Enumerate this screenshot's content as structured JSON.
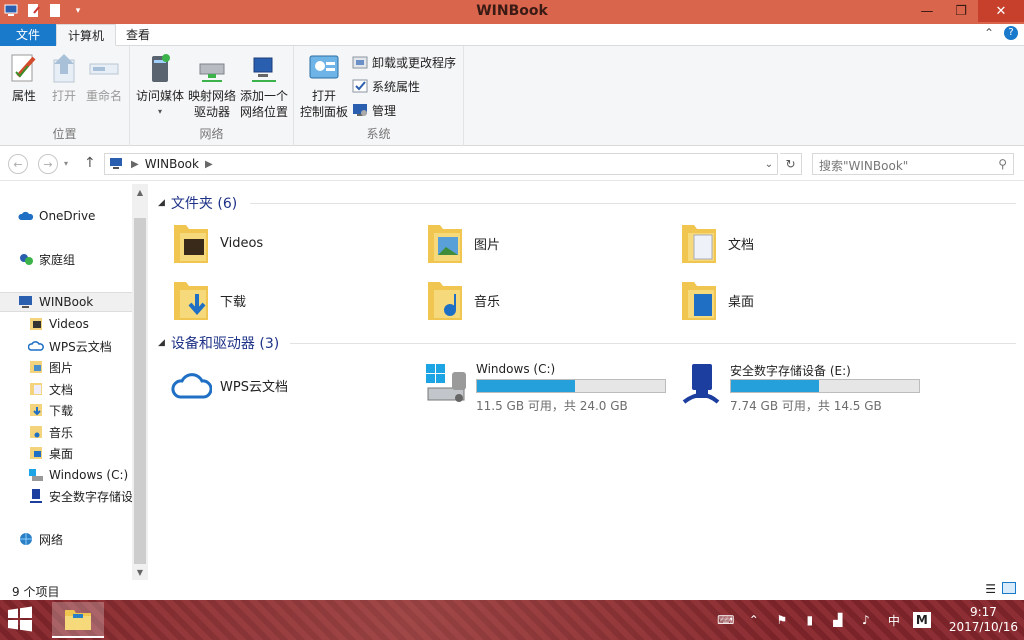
{
  "window": {
    "title": "WINBook"
  },
  "window_controls": {
    "minimize": "—",
    "maximize": "❐",
    "close": "✕"
  },
  "ribbon_tabs": {
    "file": "文件",
    "computer": "计算机",
    "view": "查看"
  },
  "ribbon": {
    "location_group": {
      "name": "位置",
      "properties": "属性",
      "open": "打开",
      "rename": "重命名"
    },
    "network_group": {
      "name": "网络",
      "access_media_1": "访问媒体",
      "map_drive_1": "映射网络",
      "map_drive_2": "驱动器",
      "add_location_1": "添加一个",
      "add_location_2": "网络位置"
    },
    "system_group": {
      "name": "系统",
      "open_cp_1": "打开",
      "open_cp_2": "控制面板",
      "uninstall": "卸载或更改程序",
      "sys_props": "系统属性",
      "manage": "管理"
    }
  },
  "address": {
    "path": "WINBook",
    "search_placeholder": "搜索\"WINBook\""
  },
  "navpane": {
    "items": [
      {
        "label": "OneDrive"
      },
      {
        "label": "家庭组"
      },
      {
        "label": "WINBook"
      },
      {
        "label": "Videos"
      },
      {
        "label": "WPS云文档"
      },
      {
        "label": "图片"
      },
      {
        "label": "文档"
      },
      {
        "label": "下载"
      },
      {
        "label": "音乐"
      },
      {
        "label": "桌面"
      },
      {
        "label": "Windows (C:)"
      },
      {
        "label": "安全数字存储设"
      },
      {
        "label": "网络"
      }
    ]
  },
  "content": {
    "folders_header": "文件夹 (6)",
    "devices_header": "设备和驱动器 (3)",
    "folders": [
      {
        "label": "Videos"
      },
      {
        "label": "图片"
      },
      {
        "label": "文档"
      },
      {
        "label": "下载"
      },
      {
        "label": "音乐"
      },
      {
        "label": "桌面"
      }
    ],
    "devices": [
      {
        "label": "WPS云文档"
      },
      {
        "label": "Windows (C:)",
        "free": "11.5 GB 可用，共 24.0 GB",
        "used_fraction": 0.52
      },
      {
        "label": "安全数字存储设备 (E:)",
        "free": "7.74 GB 可用，共 14.5 GB",
        "used_fraction": 0.47
      }
    ]
  },
  "status": {
    "item_count": "9 个项目"
  },
  "taskbar": {
    "ime": "中",
    "ime_mode": "M",
    "time": "9:17",
    "date": "2017/10/16"
  },
  "colors": {
    "titlebar": "#d9654c",
    "accent": "#1979ca",
    "drive_fill": "#26a0da"
  }
}
